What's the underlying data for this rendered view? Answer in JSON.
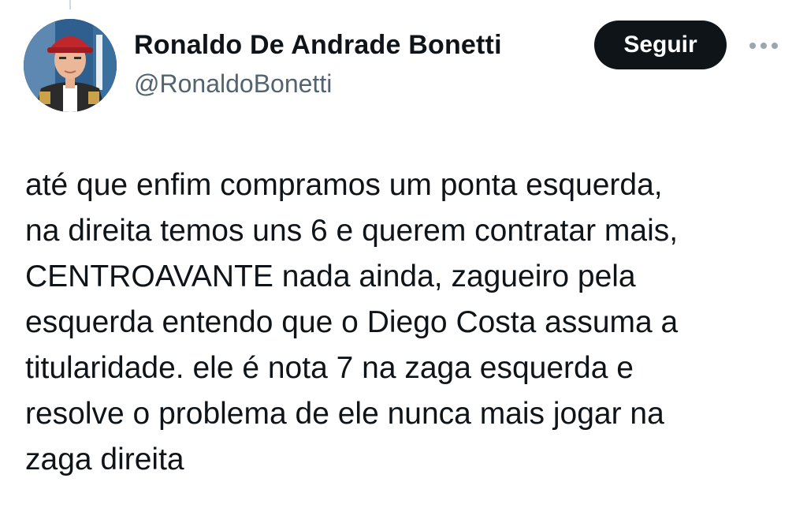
{
  "tweet": {
    "author": {
      "name": "Ronaldo De Andrade Bonetti",
      "handle": "@RonaldoBonetti",
      "avatar_icon": "profile-photo"
    },
    "follow_label": "Seguir",
    "more_icon": "more-horizontal-icon",
    "text_lines": [
      "até que enfim compramos um ponta esquerda,",
      "na direita temos uns 6 e querem contratar mais,",
      "CENTROAVANTE nada ainda, zagueiro pela",
      "esquerda entendo que o Diego Costa assuma a",
      "titularidade. ele é nota 7 na zaga esquerda e",
      "resolve o problema de ele nunca mais jogar na",
      "zaga direita"
    ]
  },
  "colors": {
    "text_primary": "#0f1419",
    "text_secondary": "#536471",
    "follow_button_bg": "#0f1419",
    "follow_button_text": "#ffffff",
    "background": "#ffffff"
  }
}
